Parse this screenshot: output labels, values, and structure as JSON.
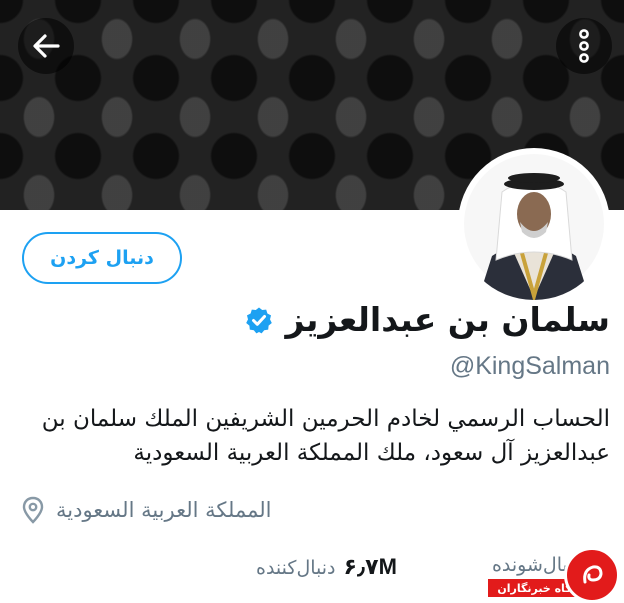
{
  "header": {
    "back_icon": "arrow-left-icon",
    "menu_icon": "more-vertical-icon"
  },
  "profile": {
    "follow_label": "دنبال کردن",
    "name": "سلمان بن عبدالعزيز",
    "verified_icon": "verified-badge-icon",
    "handle": "@KingSalman",
    "bio": "الحساب الرسمي لخادم الحرمين الشريفين الملك سلمان بن عبدالعزيز آل سعود، ملك المملكة العربية السعودية",
    "location_icon": "location-pin-icon",
    "location": "المملكة العربية السعودية"
  },
  "stats": {
    "followers_value": "۶٫۷M",
    "followers_label": "دنبال‌کننده",
    "following_label": "دنبال‌شونده"
  },
  "watermark": {
    "text": "باشگاه خبرنگاران"
  },
  "colors": {
    "accent": "#1da1f2",
    "text": "#14171a",
    "muted": "#657786",
    "watermark": "#e21b1b"
  }
}
